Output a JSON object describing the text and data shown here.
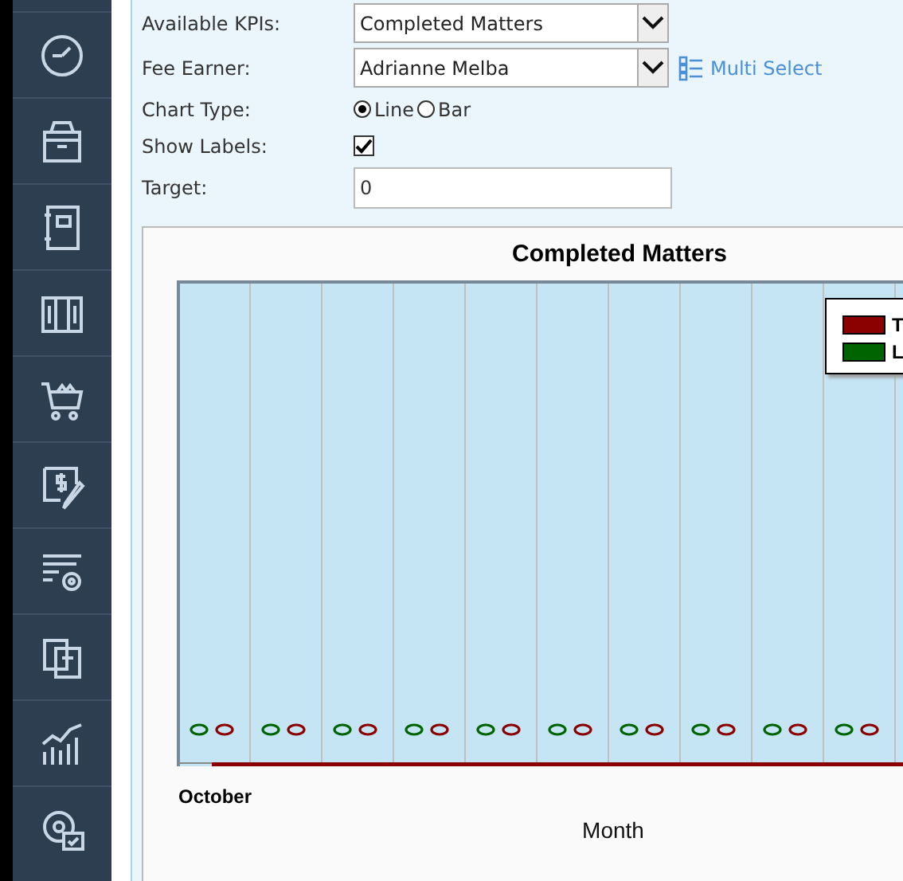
{
  "form": {
    "fields": [
      {
        "kind": "select",
        "label": "Available KPIs:",
        "value": "Completed Matters"
      },
      {
        "kind": "select",
        "label": "Fee Earner:",
        "value": "Adrianne Melba",
        "link": "Multi Select"
      },
      {
        "kind": "radio",
        "label": "Chart Type:",
        "options": [
          {
            "label": "Line",
            "selected": true
          },
          {
            "label": "Bar",
            "selected": false
          }
        ]
      },
      {
        "kind": "checkbox",
        "label": "Show Labels:",
        "checked": true
      },
      {
        "kind": "text",
        "label": "Target:",
        "value": "0"
      }
    ]
  },
  "chart": {
    "title": "Completed Matters",
    "xlabel": "Month",
    "first_category": "October",
    "legend": [
      {
        "label": "T",
        "color": "#8b0000"
      },
      {
        "label": "L",
        "color": "#006400"
      }
    ]
  }
}
